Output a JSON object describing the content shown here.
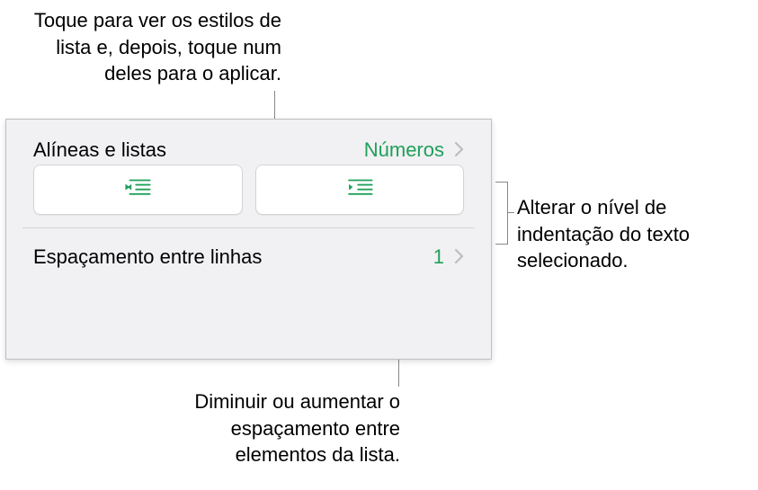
{
  "annotations": {
    "top": "Toque para ver os estilos de lista e, depois, toque num deles para o aplicar.",
    "right": "Alterar o nível de indentação do texto selecionado.",
    "bottom": "Diminuir ou aumentar o espaçamento entre elementos da lista."
  },
  "panel": {
    "bullets_label": "Alíneas e listas",
    "list_style_value": "Números",
    "spacing_label": "Espaçamento entre linhas",
    "spacing_value": "1"
  },
  "colors": {
    "accent": "#1fa05a"
  }
}
